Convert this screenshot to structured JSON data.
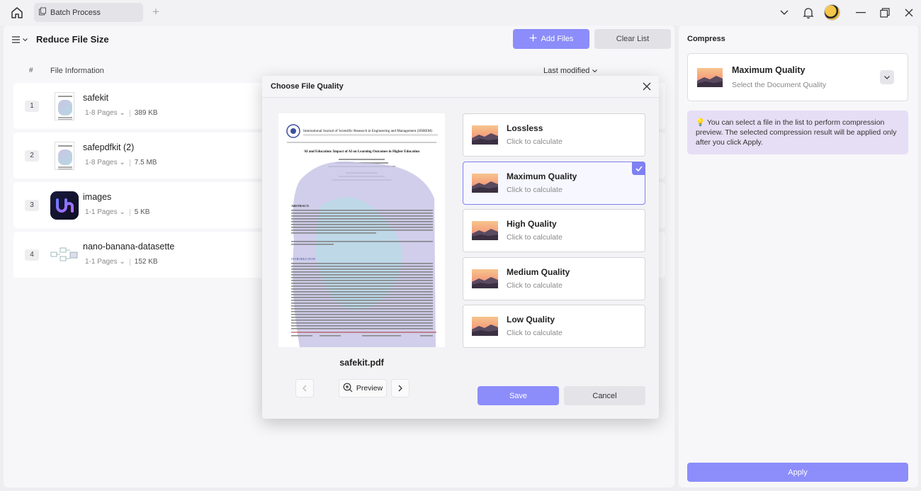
{
  "titlebar": {
    "tab_label": "Batch Process"
  },
  "main": {
    "title": "Reduce File Size",
    "add_files_label": "Add Files",
    "clear_list_label": "Clear List",
    "columns": {
      "index": "#",
      "info": "File Information",
      "sort": "Last modified"
    },
    "files": [
      {
        "index": "1",
        "name": "safekit",
        "pages": "1-8 Pages",
        "size": "389 KB"
      },
      {
        "index": "2",
        "name": "safepdfkit (2)",
        "pages": "1-8 Pages",
        "size": "7.5 MB"
      },
      {
        "index": "3",
        "name": "images",
        "pages": "1-1 Pages",
        "size": "5 KB"
      },
      {
        "index": "4",
        "name": "nano-banana-datasette",
        "pages": "1-1 Pages",
        "size": "152 KB"
      }
    ]
  },
  "side": {
    "title": "Compress",
    "card_title": "Maximum Quality",
    "card_sub": "Select the Document Quality",
    "hint": "You can select a file in the list to perform compression preview. The selected compression result will be applied only after you click Apply.",
    "apply_label": "Apply"
  },
  "modal": {
    "title": "Choose File Quality",
    "preview_filename": "safekit.pdf",
    "preview_label": "Preview",
    "doc": {
      "journal": "International Journal of Scientific Research in Engineering and Management (IJSREM)",
      "paper_title": "AI and Education: Impact of AI on Learning Outcomes in Higher Education",
      "abstract_label": "ABSTRACT:",
      "intro_label": "INTRODUCTION"
    },
    "options": [
      {
        "title": "Lossless",
        "sub": "Click to calculate"
      },
      {
        "title": "Maximum Quality",
        "sub": "Click to calculate"
      },
      {
        "title": "High Quality",
        "sub": "Click to calculate"
      },
      {
        "title": "Medium Quality",
        "sub": "Click to calculate"
      },
      {
        "title": "Low Quality",
        "sub": "Click to calculate"
      }
    ],
    "selected_index": 1,
    "save_label": "Save",
    "cancel_label": "Cancel"
  },
  "colors": {
    "accent": "#8c8dfa",
    "selected_border": "#7f80f3",
    "hint_bg": "#e6def4"
  }
}
